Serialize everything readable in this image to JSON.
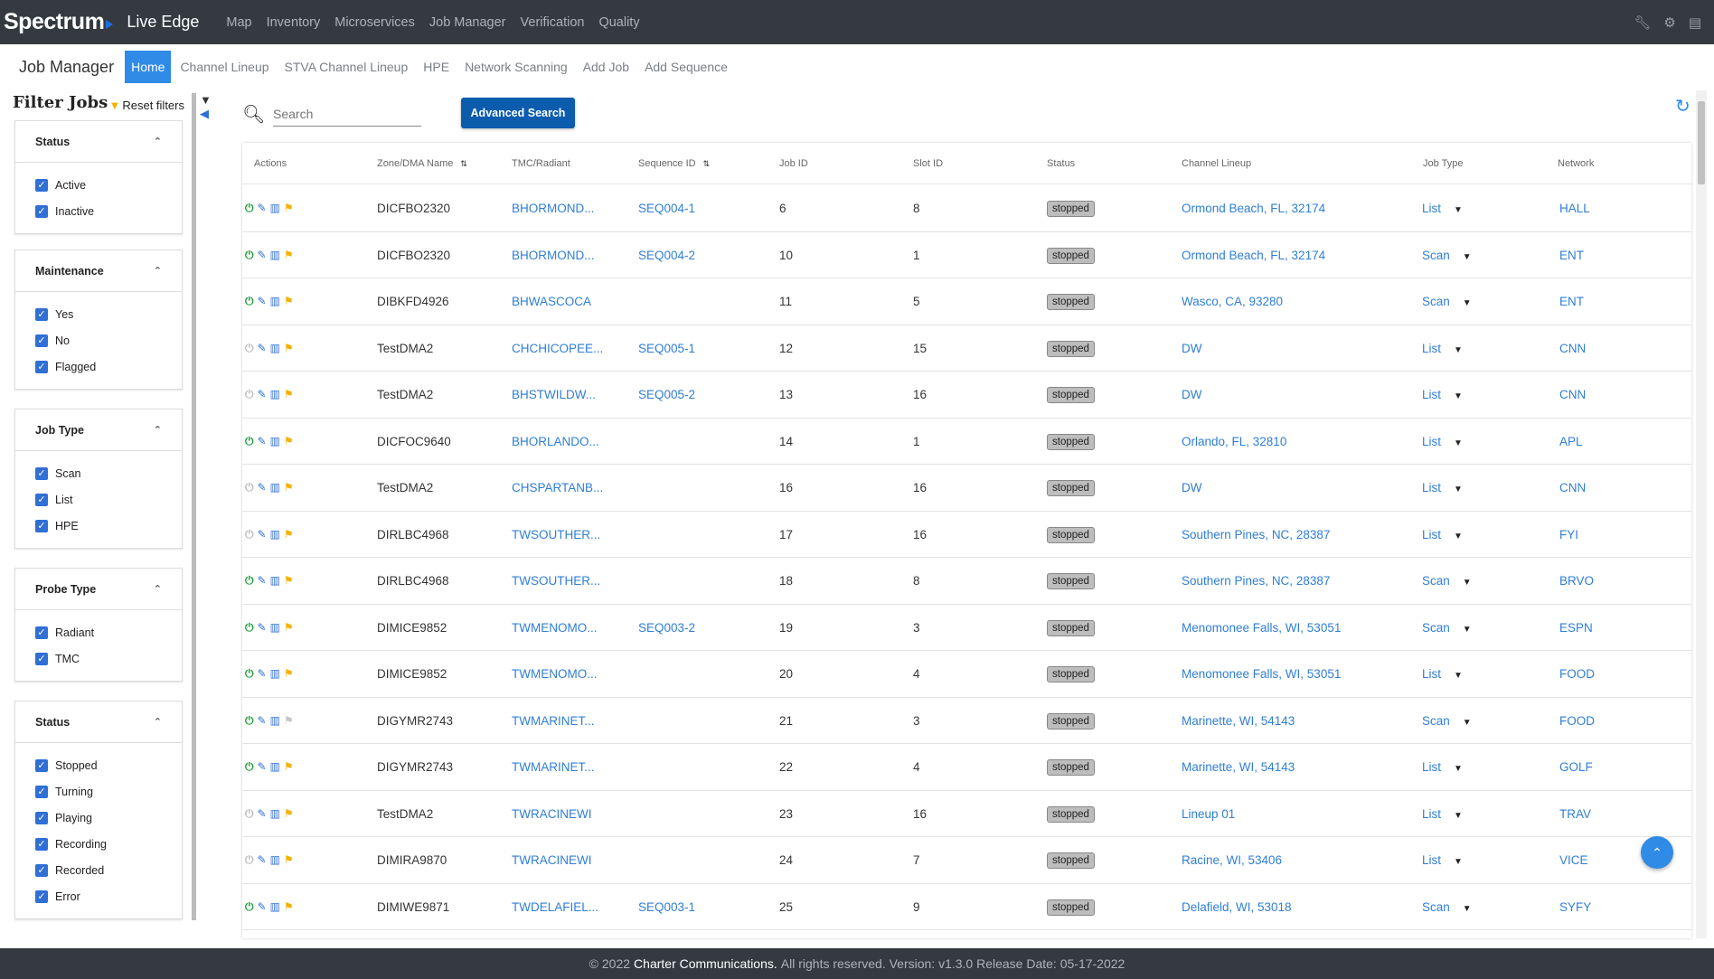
{
  "topnav": {
    "brand": "Spectrum",
    "app_name": "Live Edge",
    "links": [
      "Map",
      "Inventory",
      "Microservices",
      "Job Manager",
      "Verification",
      "Quality"
    ],
    "icons": [
      "wrench-icon",
      "gear-icon",
      "book-icon"
    ]
  },
  "subnav": {
    "title": "Job Manager",
    "tabs": [
      "Home",
      "Channel Lineup",
      "STVA Channel Lineup",
      "HPE",
      "Network Scanning",
      "Add Job",
      "Add Sequence"
    ],
    "active_tab": "Home"
  },
  "sidebar": {
    "title": "Filter Jobs",
    "reset_label": "Reset filters",
    "sections": [
      {
        "title": "Status",
        "options": [
          "Active",
          "Inactive"
        ]
      },
      {
        "title": "Maintenance",
        "options": [
          "Yes",
          "No",
          "Flagged"
        ]
      },
      {
        "title": "Job Type",
        "options": [
          "Scan",
          "List",
          "HPE"
        ]
      },
      {
        "title": "Probe Type",
        "options": [
          "Radiant",
          "TMC"
        ]
      },
      {
        "title": "Status",
        "options": [
          "Stopped",
          "Turning",
          "Playing",
          "Recording",
          "Recorded",
          "Error"
        ]
      }
    ]
  },
  "search": {
    "placeholder": "Search",
    "advanced_label": "Advanced Search"
  },
  "table": {
    "headers": [
      "Actions",
      "Zone/DMA Name",
      "TMC/Radiant",
      "Sequence ID",
      "Job ID",
      "Slot ID",
      "Status",
      "Channel Lineup",
      "Job Type",
      "Network"
    ],
    "rows": [
      {
        "power": "on",
        "flag": "on",
        "zone": "DICFBO2320",
        "tmc": "BHORMOND...",
        "seq": "SEQ004-1",
        "job": "6",
        "slot": "8",
        "status": "stopped",
        "lineup": "Ormond Beach, FL, 32174",
        "type": "List",
        "network": "HALL"
      },
      {
        "power": "on",
        "flag": "on",
        "zone": "DICFBO2320",
        "tmc": "BHORMOND...",
        "seq": "SEQ004-2",
        "job": "10",
        "slot": "1",
        "status": "stopped",
        "lineup": "Ormond Beach, FL, 32174",
        "type": "Scan",
        "network": "ENT"
      },
      {
        "power": "on",
        "flag": "on",
        "zone": "DIBKFD4926",
        "tmc": "BHWASCOCA",
        "seq": "",
        "job": "11",
        "slot": "5",
        "status": "stopped",
        "lineup": "Wasco, CA, 93280",
        "type": "Scan",
        "network": "ENT"
      },
      {
        "power": "off",
        "flag": "on",
        "zone": "TestDMA2",
        "tmc": "CHCHICOPEE...",
        "seq": "SEQ005-1",
        "job": "12",
        "slot": "15",
        "status": "stopped",
        "lineup": "DW",
        "type": "List",
        "network": "CNN"
      },
      {
        "power": "off",
        "flag": "on",
        "zone": "TestDMA2",
        "tmc": "BHSTWILDW...",
        "seq": "SEQ005-2",
        "job": "13",
        "slot": "16",
        "status": "stopped",
        "lineup": "DW",
        "type": "List",
        "network": "CNN"
      },
      {
        "power": "on",
        "flag": "on",
        "zone": "DICFOC9640",
        "tmc": "BHORLANDO...",
        "seq": "",
        "job": "14",
        "slot": "1",
        "status": "stopped",
        "lineup": "Orlando, FL, 32810",
        "type": "List",
        "network": "APL"
      },
      {
        "power": "off",
        "flag": "on",
        "zone": "TestDMA2",
        "tmc": "CHSPARTANB...",
        "seq": "",
        "job": "16",
        "slot": "16",
        "status": "stopped",
        "lineup": "DW",
        "type": "List",
        "network": "CNN"
      },
      {
        "power": "off",
        "flag": "on",
        "zone": "DIRLBC4968",
        "tmc": "TWSOUTHER...",
        "seq": "",
        "job": "17",
        "slot": "16",
        "status": "stopped",
        "lineup": "Southern Pines, NC, 28387",
        "type": "List",
        "network": "FYI"
      },
      {
        "power": "on",
        "flag": "on",
        "zone": "DIRLBC4968",
        "tmc": "TWSOUTHER...",
        "seq": "",
        "job": "18",
        "slot": "8",
        "status": "stopped",
        "lineup": "Southern Pines, NC, 28387",
        "type": "Scan",
        "network": "BRVO"
      },
      {
        "power": "on",
        "flag": "on",
        "zone": "DIMICE9852",
        "tmc": "TWMENOMO...",
        "seq": "SEQ003-2",
        "job": "19",
        "slot": "3",
        "status": "stopped",
        "lineup": "Menomonee Falls, WI, 53051",
        "type": "Scan",
        "network": "ESPN"
      },
      {
        "power": "on",
        "flag": "on",
        "zone": "DIMICE9852",
        "tmc": "TWMENOMO...",
        "seq": "",
        "job": "20",
        "slot": "4",
        "status": "stopped",
        "lineup": "Menomonee Falls, WI, 53051",
        "type": "List",
        "network": "FOOD"
      },
      {
        "power": "on",
        "flag": "off",
        "zone": "DIGYMR2743",
        "tmc": "TWMARINET...",
        "seq": "",
        "job": "21",
        "slot": "3",
        "status": "stopped",
        "lineup": "Marinette, WI, 54143",
        "type": "Scan",
        "network": "FOOD"
      },
      {
        "power": "on",
        "flag": "on",
        "zone": "DIGYMR2743",
        "tmc": "TWMARINET...",
        "seq": "",
        "job": "22",
        "slot": "4",
        "status": "stopped",
        "lineup": "Marinette, WI, 54143",
        "type": "List",
        "network": "GOLF"
      },
      {
        "power": "off",
        "flag": "on",
        "zone": "TestDMA2",
        "tmc": "TWRACINEWI",
        "seq": "",
        "job": "23",
        "slot": "16",
        "status": "stopped",
        "lineup": "Lineup 01",
        "type": "List",
        "network": "TRAV"
      },
      {
        "power": "off",
        "flag": "on",
        "zone": "DIMIRA9870",
        "tmc": "TWRACINEWI",
        "seq": "",
        "job": "24",
        "slot": "7",
        "status": "stopped",
        "lineup": "Racine, WI, 53406",
        "type": "List",
        "network": "VICE"
      },
      {
        "power": "on",
        "flag": "on",
        "zone": "DIMIWE9871",
        "tmc": "TWDELAFIEL...",
        "seq": "SEQ003-1",
        "job": "25",
        "slot": "9",
        "status": "stopped",
        "lineup": "Delafield, WI, 53018",
        "type": "Scan",
        "network": "SYFY"
      }
    ]
  },
  "footer": {
    "copyright_symbol": "©",
    "year": "2022",
    "company": "Charter Communications.",
    "rest": "All rights reserved. Version: v1.3.0 Release Date: 05-17-2022"
  },
  "colors": {
    "navbar": "#343a40",
    "accent": "#2f8be6",
    "button": "#0b5cad",
    "link": "#2f7ed8",
    "power_on": "#1e9e3a",
    "flag": "#f1b200"
  }
}
